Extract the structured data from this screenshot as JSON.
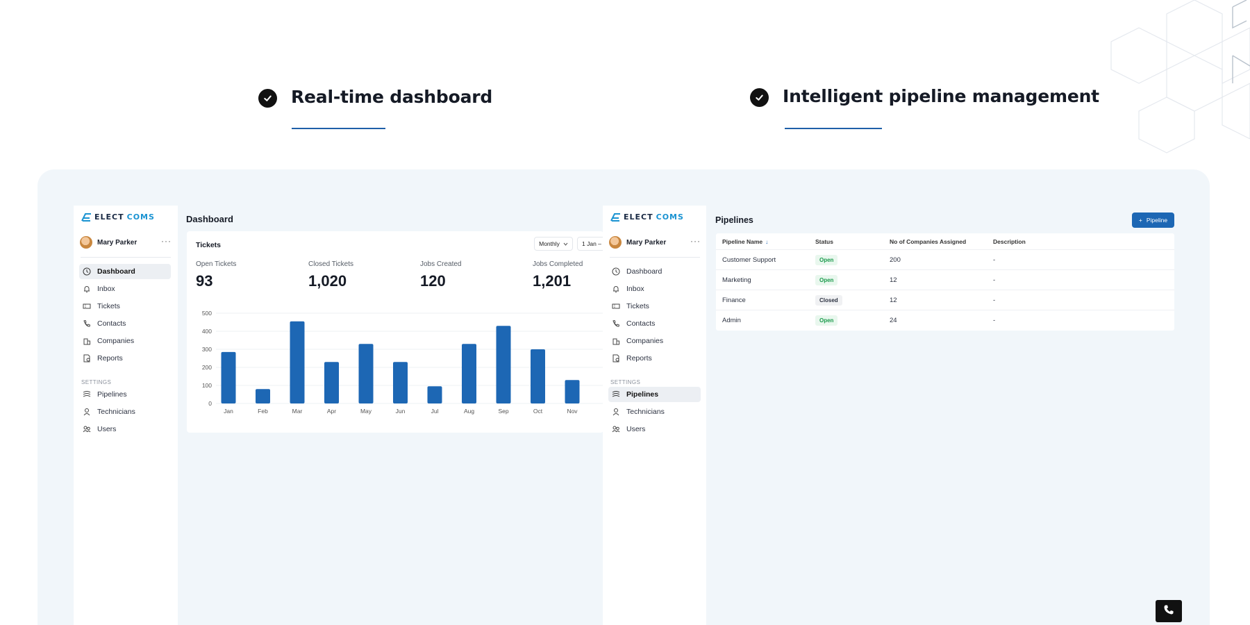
{
  "features": [
    {
      "title": "Real-time dashboard"
    },
    {
      "title": "Intelligent pipeline management"
    }
  ],
  "colors": {
    "accent": "#1e5fa8",
    "bar": "#1d67b4",
    "panel_bg": "#f1f6fa",
    "open_green": "#1a9a4b"
  },
  "brand": {
    "logo_part1": "ELECT",
    "logo_part2": "COMS"
  },
  "user": {
    "name": "Mary Parker",
    "menu": "···"
  },
  "sidebar": {
    "items": [
      {
        "label": "Dashboard",
        "icon": "clock-icon"
      },
      {
        "label": "Inbox",
        "icon": "bell-icon"
      },
      {
        "label": "Tickets",
        "icon": "ticket-icon"
      },
      {
        "label": "Contacts",
        "icon": "phone-contacts-icon"
      },
      {
        "label": "Companies",
        "icon": "building-icon"
      },
      {
        "label": "Reports",
        "icon": "report-icon"
      }
    ],
    "settings_label": "SETTINGS",
    "settings_items": [
      {
        "label": "Pipelines",
        "icon": "pipeline-icon"
      },
      {
        "label": "Technicians",
        "icon": "technician-icon"
      },
      {
        "label": "Users",
        "icon": "users-icon"
      }
    ]
  },
  "dashboard": {
    "title": "Dashboard",
    "card_title": "Tickets",
    "period": "Monthly",
    "date_range": "1 Jan –",
    "stats": [
      {
        "label": "Open Tickets",
        "value": "93"
      },
      {
        "label": "Closed Tickets",
        "value": "1,020"
      },
      {
        "label": "Jobs Created",
        "value": "120"
      },
      {
        "label": "Jobs Completed",
        "value": "1,201"
      }
    ]
  },
  "chart_data": {
    "type": "bar",
    "categories": [
      "Jan",
      "Feb",
      "Mar",
      "Apr",
      "May",
      "Jun",
      "Jul",
      "Aug",
      "Sep",
      "Oct",
      "Nov"
    ],
    "values": [
      285,
      80,
      455,
      230,
      330,
      230,
      95,
      330,
      430,
      300,
      130
    ],
    "ylim": [
      0,
      500
    ],
    "yticks": [
      0,
      100,
      200,
      300,
      400,
      500
    ],
    "grid": true,
    "title": "",
    "xlabel": "",
    "ylabel": ""
  },
  "pipelines": {
    "title": "Pipelines",
    "add_label": "Pipeline",
    "columns": [
      "Pipeline Name",
      "Status",
      "No of Companies Assigned",
      "Description"
    ],
    "rows": [
      {
        "name": "Customer Support",
        "status": "Open",
        "companies": "200",
        "description": "-"
      },
      {
        "name": "Marketing",
        "status": "Open",
        "companies": "12",
        "description": "-"
      },
      {
        "name": "Finance",
        "status": "Closed",
        "companies": "12",
        "description": "-"
      },
      {
        "name": "Admin",
        "status": "Open",
        "companies": "24",
        "description": "-"
      }
    ]
  }
}
